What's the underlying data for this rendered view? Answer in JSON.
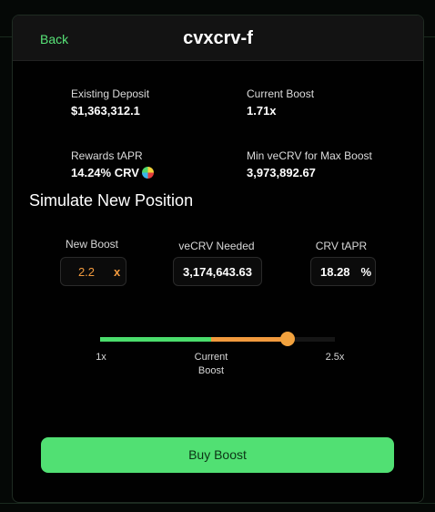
{
  "header": {
    "back_label": "Back",
    "title": "cvxcrv-f"
  },
  "stats": {
    "existing_deposit": {
      "label": "Existing Deposit",
      "value": "$1,363,312.1"
    },
    "current_boost": {
      "label": "Current Boost",
      "value": "1.71x"
    },
    "rewards_tapr": {
      "label": "Rewards tAPR",
      "value": "14.24% CRV",
      "icon": "crv-token-icon"
    },
    "min_vecrv": {
      "label": "Min veCRV for Max Boost",
      "value": "3,973,892.67"
    }
  },
  "simulate": {
    "title": "Simulate New Position",
    "new_boost": {
      "label": "New Boost",
      "value": "2.2",
      "unit": "x"
    },
    "vecrv_needed": {
      "label": "veCRV Needed",
      "value": "3,174,643.63"
    },
    "crv_tapr": {
      "label": "CRV tAPR",
      "value": "18.28",
      "unit": "%"
    }
  },
  "slider": {
    "min_label": "1x",
    "current_label_line1": "Current",
    "current_label_line2": "Boost",
    "max_label": "2.5x",
    "min": 1,
    "max": 2.5,
    "current": 1.71,
    "value": 2.2
  },
  "colors": {
    "accent_green": "#51e073",
    "accent_orange": "#f19a3e"
  },
  "buy_button": {
    "label": "Buy Boost"
  }
}
